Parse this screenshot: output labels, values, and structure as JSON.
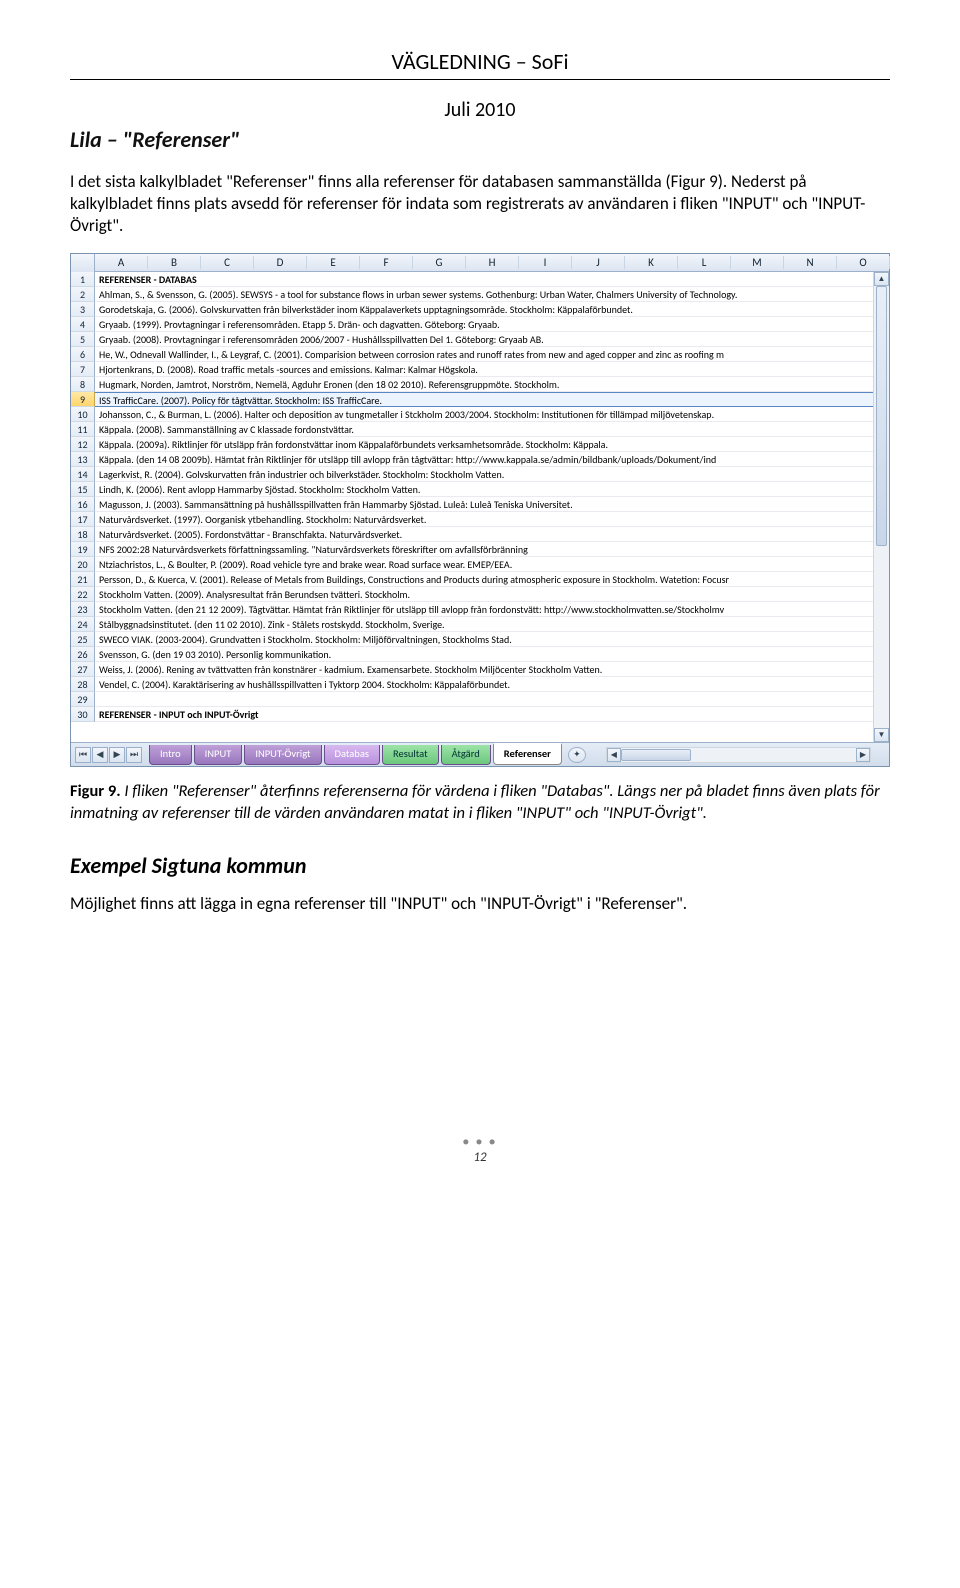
{
  "header": {
    "title": "VÄGLEDNING – SoFi",
    "subtitle": "Juli 2010"
  },
  "section": {
    "title": "Lila – \"Referenser\"",
    "para": "I det sista kalkylbladet \"Referenser\" finns alla referenser för databasen sammanställda (Figur 9). Nederst på kalkylbladet finns plats avsedd för referenser för indata som registrerats av användaren i fliken \"INPUT\" och \"INPUT-Övrigt\"."
  },
  "caption": {
    "label": "Figur 9.",
    "text": " I fliken \"Referenser\" återfinns referenserna för värdena i fliken \"Databas\". Längs ner på bladet finns även plats för inmatning av referenser till de värden användaren matat in i fliken \"INPUT\" och \"INPUT-Övrigt\"."
  },
  "example": {
    "heading": "Exempel Sigtuna kommun",
    "text": "Möjlighet finns att lägga in egna referenser till \"INPUT\" och \"INPUT-Övrigt\" i \"Referenser\"."
  },
  "sheet": {
    "cols": [
      "A",
      "B",
      "C",
      "D",
      "E",
      "F",
      "G",
      "H",
      "I",
      "J",
      "K",
      "L",
      "M",
      "N",
      "O"
    ],
    "rows": [
      {
        "n": 1,
        "text": "REFERENSER - DATABAS",
        "bold": true
      },
      {
        "n": 2,
        "text": "Ahlman, S., & Svensson, G. (2005). SEWSYS - a tool for substance flows in urban sewer systems. Gothenburg: Urban Water, Chalmers University of Technology."
      },
      {
        "n": 3,
        "text": "Gorodetskaja, G. (2006). Golvskurvatten från bilverkstäder inom Käppalaverkets upptagningsområde. Stockholm: Käppalaförbundet."
      },
      {
        "n": 4,
        "text": "Gryaab. (1999). Provtagningar i referensområden. Etapp 5. Drän- och dagvatten. Göteborg: Gryaab."
      },
      {
        "n": 5,
        "text": "Gryaab. (2008). Provtagningar i referensområden 2006/2007 - Hushållsspillvatten Del 1. Göteborg: Gryaab AB."
      },
      {
        "n": 6,
        "text": "He, W., Odnevall Wallinder, I., & Leygraf, C. (2001). Comparision between corrosion rates and runoff rates from new and aged copper and zinc as roofing m"
      },
      {
        "n": 7,
        "text": "Hjortenkrans, D. (2008). Road traffic metals -sources and emissions. Kalmar: Kalmar Högskola."
      },
      {
        "n": 8,
        "text": "Hugmark, Norden, Jamtrot, Norström, Nemelä, Agduhr Eronen (den 18 02 2010). Referensgruppmöte. Stockholm."
      },
      {
        "n": 9,
        "text": "ISS TrafficCare. (2007). Policy för tågtvättar. Stockholm: ISS TrafficCare.",
        "selected": true
      },
      {
        "n": 10,
        "text": "Johansson, C., & Burman, L. (2006). Halter och deposition av tungmetaller i Stckholm 2003/2004. Stockholm: Institutionen för tillämpad miljövetenskap."
      },
      {
        "n": 11,
        "text": "Käppala. (2008). Sammanställning av C klassade fordonstvättar."
      },
      {
        "n": 12,
        "text": "Käppala. (2009a). Riktlinjer för utsläpp från fordonstvättar inom Käppalaförbundets verksamhetsområde. Stockholm: Käppala."
      },
      {
        "n": 13,
        "text": "Käppala. (den 14 08 2009b). Hämtat från Riktlinjer för utsläpp till avlopp från tågtvättar: http://www.kappala.se/admin/bildbank/uploads/Dokument/ind"
      },
      {
        "n": 14,
        "text": "Lagerkvist, R. (2004). Golvskurvatten från industrier och bilverkstäder. Stockholm: Stockholm Vatten."
      },
      {
        "n": 15,
        "text": "Lindh, K. (2006). Rent avlopp Hammarby Sjöstad. Stockholm: Stockholm Vatten."
      },
      {
        "n": 16,
        "text": "Magusson, J. (2003). Sammansättning på hushållsspillvatten från Hammarby Sjöstad. Luleå: Luleå Teniska Universitet."
      },
      {
        "n": 17,
        "text": "Naturvårdsverket. (1997). Oorganisk ytbehandling. Stockholm: Naturvårdsverket."
      },
      {
        "n": 18,
        "text": "Naturvårdsverket. (2005). Fordonstvättar - Branschfakta. Naturvårdsverket."
      },
      {
        "n": 19,
        "text": "NFS 2002:28 Naturvårdsverkets författningssamling. \"Naturvårdsverkets föreskrifter om avfallsförbränning"
      },
      {
        "n": 20,
        "text": "Ntziachristos, L., & Boulter, P. (2009). Road vehicle tyre and brake wear. Road surface wear. EMEP/EEA."
      },
      {
        "n": 21,
        "text": "Persson, D., & Kuerca, V. (2001). Release of Metals from Buildings, Constructions and Products during atmospheric exposure in Stockholm. Watetion: Focusr"
      },
      {
        "n": 22,
        "text": "Stockholm Vatten. (2009). Analysresultat från Berundsen tvätteri. Stockholm."
      },
      {
        "n": 23,
        "text": "Stockholm Vatten. (den 21 12 2009). Tågtvättar. Hämtat från Riktlinjer för utsläpp till avlopp från fordonstvätt: http://www.stockholmvatten.se/Stockholmv"
      },
      {
        "n": 24,
        "text": "Stålbyggnadsinstitutet. (den 11 02 2010). Zink - Stålets rostskydd. Stockholm, Sverige."
      },
      {
        "n": 25,
        "text": "SWECO VIAK. (2003-2004). Grundvatten i Stockholm. Stockholm: Miljöförvaltningen, Stockholms Stad."
      },
      {
        "n": 26,
        "text": "Svensson, G. (den 19 03 2010). Personlig kommunikation."
      },
      {
        "n": 27,
        "text": "Weiss, J. (2006). Rening av tvättvatten från konstnärer - kadmium. Examensarbete. Stockholm Miljöcenter Stockholm Vatten."
      },
      {
        "n": 28,
        "text": "Vendel, C. (2004). Karaktärisering av hushållsspillvatten i Tyktorp 2004. Stockholm: Käppalaförbundet."
      },
      {
        "n": 29,
        "text": ""
      },
      {
        "n": 30,
        "text": "REFERENSER - INPUT och INPUT-Övrigt",
        "bold": true
      }
    ],
    "tabs": {
      "intro": "Intro",
      "input": "INPUT",
      "inputov": "INPUT-Övrigt",
      "databas": "Databas",
      "resultat": "Resultat",
      "atgard": "Åtgärd",
      "ref": "Referenser"
    }
  },
  "footer": {
    "dots": "● ● ●",
    "page": "12"
  }
}
